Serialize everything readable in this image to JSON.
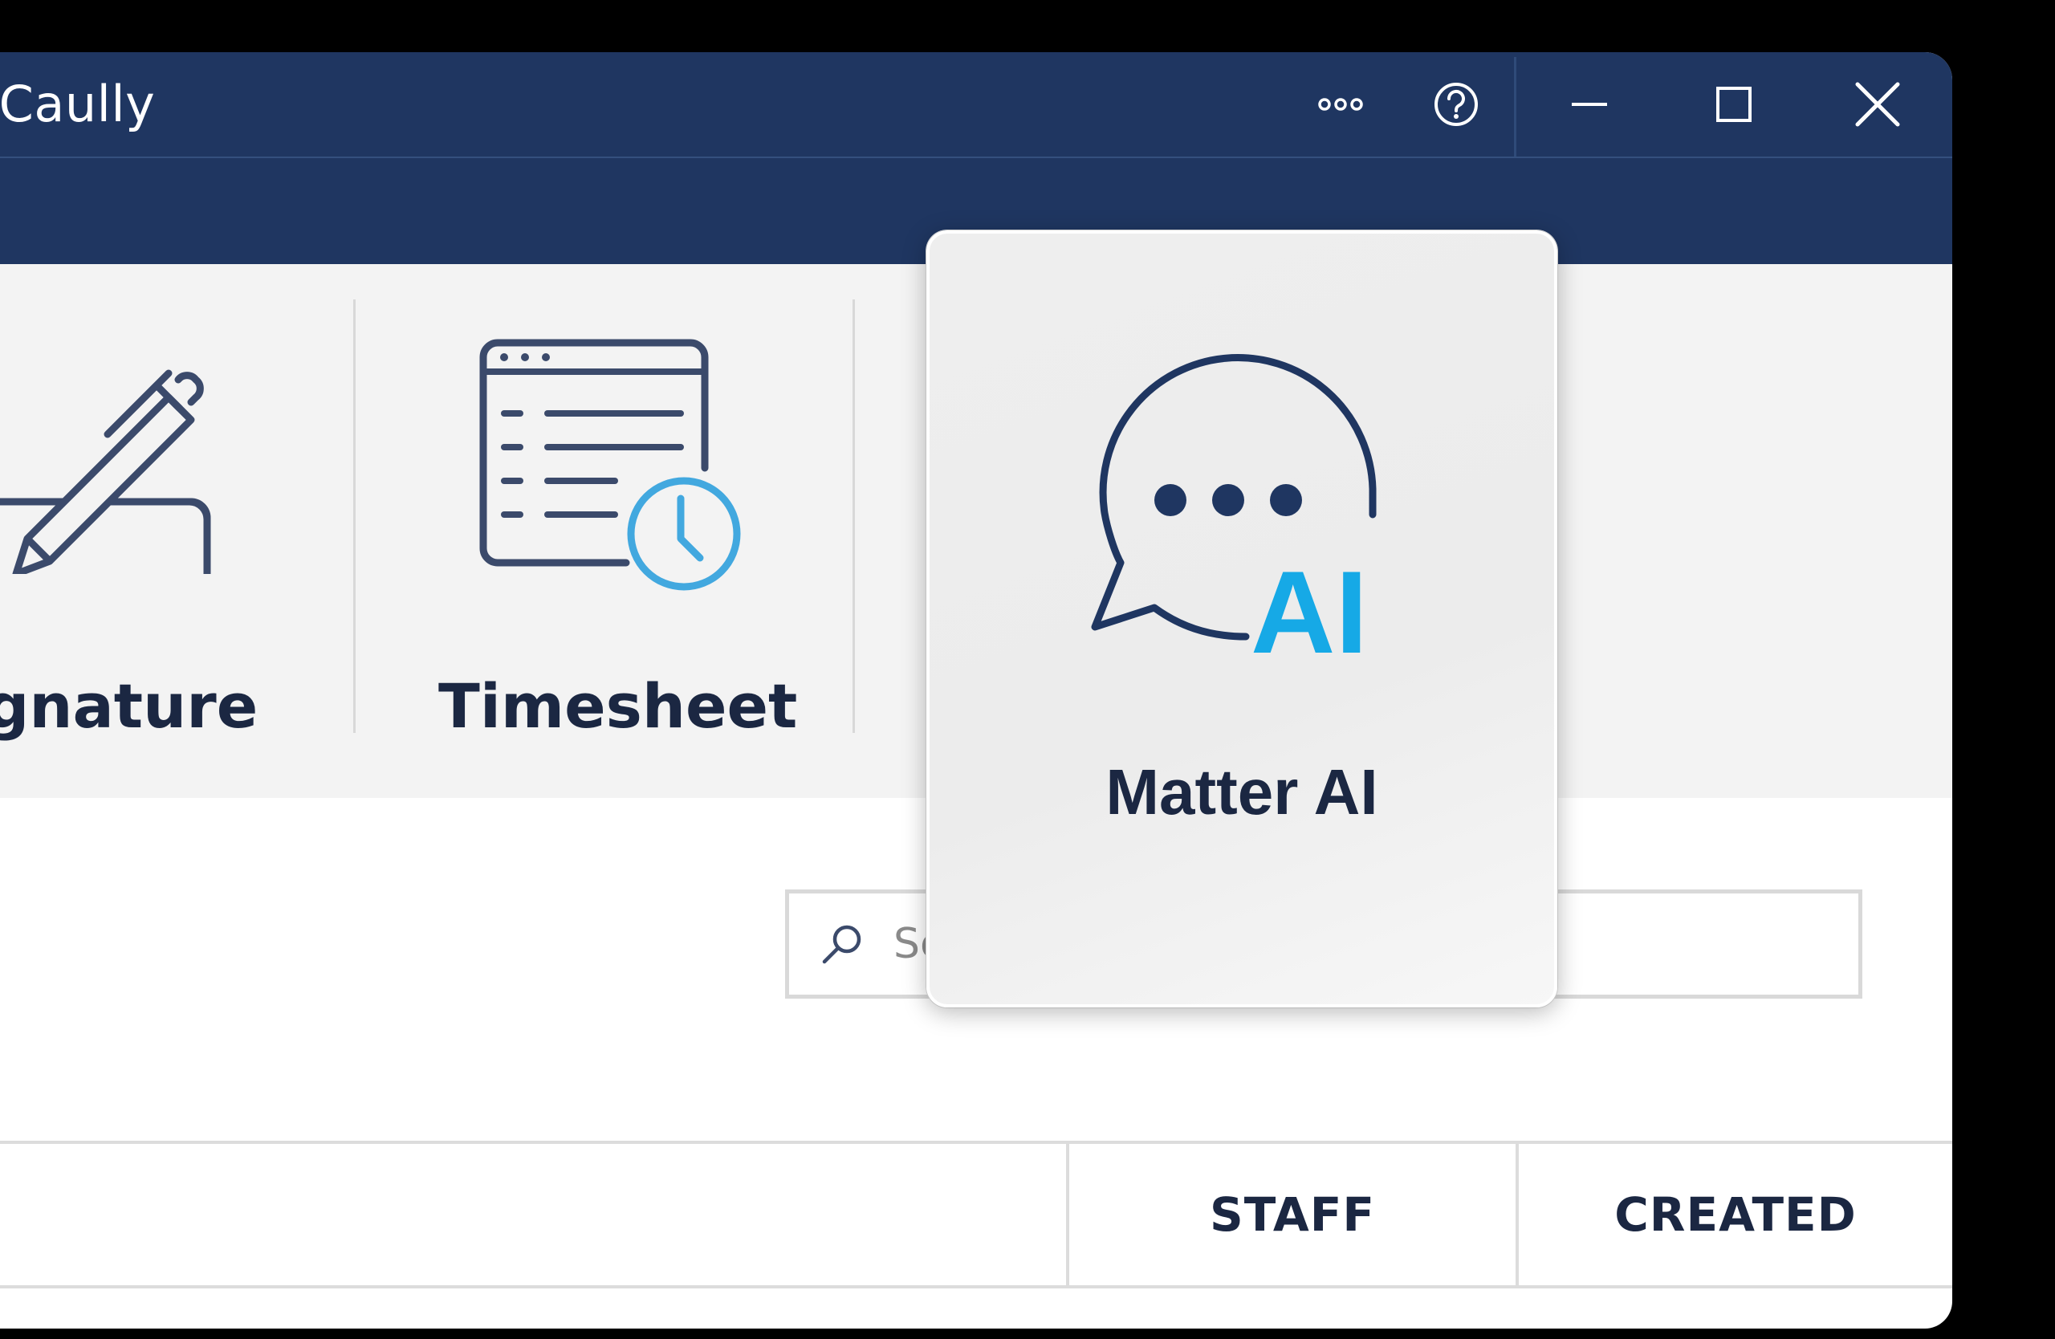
{
  "window": {
    "title": "cCaully"
  },
  "titlebar": {
    "more_icon": "more-icon",
    "help_icon": "help-icon",
    "minimize_icon": "minimize-icon",
    "maximize_icon": "maximize-icon",
    "close_icon": "close-icon"
  },
  "ribbon": {
    "tiles": [
      {
        "label": "gnature",
        "icon": "signature-pen-icon"
      },
      {
        "label": "Timesheet",
        "icon": "timesheet-icon"
      }
    ]
  },
  "ai_card": {
    "label": "Matter AI",
    "badge": "AI",
    "icon": "chat-bubble-icon"
  },
  "search": {
    "placeholder": "Search correspondence",
    "icon": "search-icon"
  },
  "table": {
    "columns": [
      "STAFF",
      "CREATED"
    ]
  },
  "colors": {
    "navy": "#1f3661",
    "text_dark": "#1b2742",
    "icon_dark": "#3b4a6b",
    "accent": "#42a8df",
    "ai_blue": "#16a9e6"
  }
}
